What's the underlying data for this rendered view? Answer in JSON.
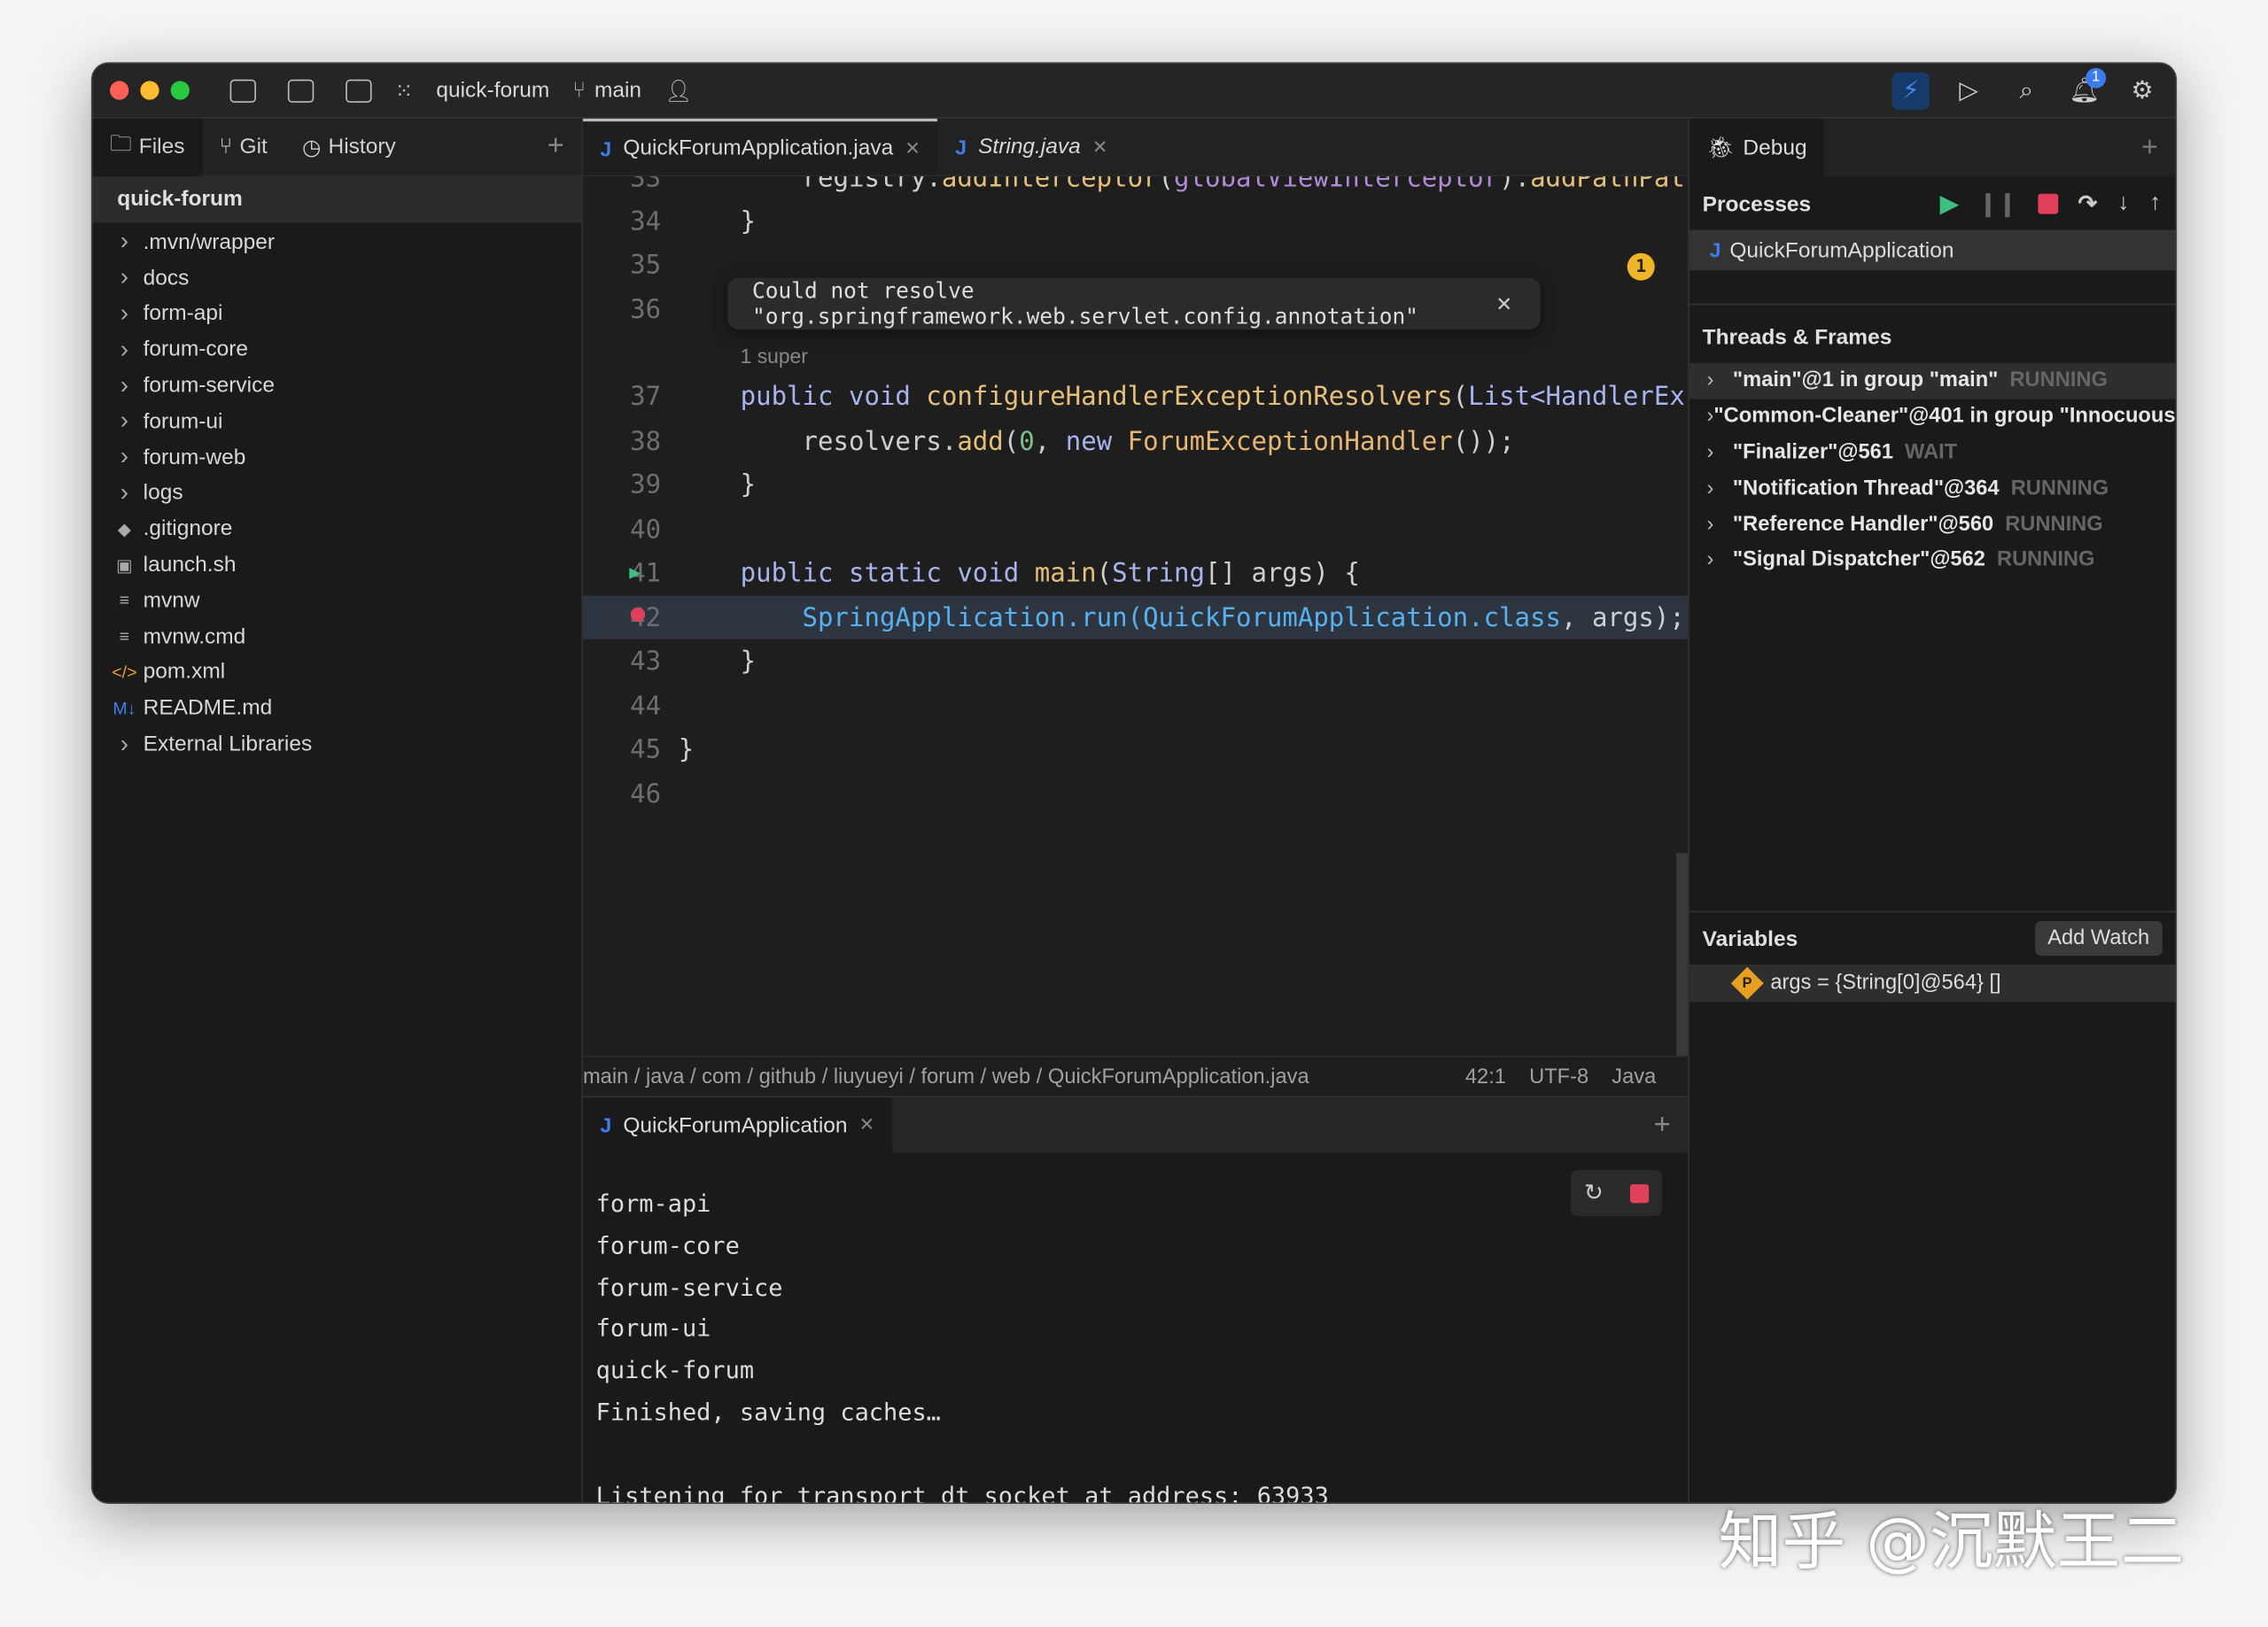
{
  "titlebar": {
    "project": "quick-forum",
    "branch": "main",
    "notifications": "1"
  },
  "left": {
    "tabs": [
      "Files",
      "Git",
      "History"
    ],
    "project": "quick-forum",
    "items": [
      {
        "label": ".mvn/wrapper",
        "icon": "chevron-right"
      },
      {
        "label": "docs",
        "icon": "chevron-right"
      },
      {
        "label": "form-api",
        "icon": "chevron-right"
      },
      {
        "label": "forum-core",
        "icon": "chevron-right"
      },
      {
        "label": "forum-service",
        "icon": "chevron-right"
      },
      {
        "label": "forum-ui",
        "icon": "chevron-right"
      },
      {
        "label": "forum-web",
        "icon": "chevron-right"
      },
      {
        "label": "logs",
        "icon": "chevron-right"
      },
      {
        "label": ".gitignore",
        "icon": "git-icon"
      },
      {
        "label": "launch.sh",
        "icon": "terminal-icon"
      },
      {
        "label": "mvnw",
        "icon": "text-file-icon"
      },
      {
        "label": "mvnw.cmd",
        "icon": "text-file-icon"
      },
      {
        "label": "pom.xml",
        "icon": "xml-icon"
      },
      {
        "label": "README.md",
        "icon": "markdown-icon"
      },
      {
        "label": "External Libraries",
        "icon": "chevron-right"
      }
    ]
  },
  "editor": {
    "tabs": [
      "QuickForumApplication.java",
      "String.java"
    ],
    "popup": "Could not resolve \"org.springframework.web.servlet.config.annotation\"",
    "warning_count": "1",
    "lines": [
      {
        "n": "33",
        "t": [
          [
            "        registry.",
            ""
          ],
          [
            "addInterceptor",
            "fn"
          ],
          [
            "(",
            ""
          ],
          [
            "globalViewInterceptor",
            "pv"
          ],
          [
            ").",
            ""
          ],
          [
            "addPathPat",
            "fn"
          ]
        ]
      },
      {
        "n": "34",
        "t": [
          [
            "    }",
            ""
          ]
        ]
      },
      {
        "n": "35",
        "t": []
      },
      {
        "n": "36",
        "t": [
          [
            "    ",
            ""
          ],
          [
            "@Override",
            "an"
          ]
        ]
      },
      {
        "n": "",
        "t": [
          [
            "    ",
            ""
          ],
          [
            "1 super",
            "hint"
          ]
        ]
      },
      {
        "n": "37",
        "t": [
          [
            "    ",
            ""
          ],
          [
            "public void ",
            "kw"
          ],
          [
            "configureHandlerExceptionResolvers",
            "fn"
          ],
          [
            "(",
            ""
          ],
          [
            "List<HandlerEx",
            "kw"
          ]
        ]
      },
      {
        "n": "38",
        "t": [
          [
            "        resolvers.",
            ""
          ],
          [
            "add",
            "fn"
          ],
          [
            "(",
            ""
          ],
          [
            "0",
            "num0"
          ],
          [
            ", ",
            ""
          ],
          [
            "new ",
            "kw"
          ],
          [
            "ForumExceptionHandler",
            "cls"
          ],
          [
            "());",
            ""
          ]
        ]
      },
      {
        "n": "39",
        "t": [
          [
            "    }",
            ""
          ]
        ]
      },
      {
        "n": "40",
        "t": []
      },
      {
        "n": "41",
        "t": [
          [
            "    ",
            ""
          ],
          [
            "public static void ",
            "kw"
          ],
          [
            "main",
            "fn"
          ],
          [
            "(",
            ""
          ],
          [
            "String",
            "kw"
          ],
          [
            "[] args) {",
            ""
          ]
        ]
      },
      {
        "n": "42",
        "t": [
          [
            "        ",
            ""
          ],
          [
            "SpringApplication.run(QuickForumApplication.class",
            "call"
          ],
          [
            ", args);",
            ""
          ]
        ]
      },
      {
        "n": "43",
        "t": [
          [
            "    }",
            ""
          ]
        ]
      },
      {
        "n": "44",
        "t": []
      },
      {
        "n": "45",
        "t": [
          [
            "}",
            ""
          ]
        ]
      },
      {
        "n": "46",
        "t": []
      }
    ]
  },
  "status": {
    "breadcrumb": "main / java / com / github / liuyueyi / forum / web / QuickForumApplication.java",
    "position": "42:1",
    "encoding": "UTF-8",
    "language": "Java"
  },
  "console": {
    "tab": "QuickForumApplication",
    "lines": [
      "form-api",
      "forum-core",
      "forum-service",
      "forum-ui",
      "quick-forum",
      "Finished, saving caches…",
      "",
      "Listening for transport dt_socket at address: 63933"
    ]
  },
  "debug": {
    "tab": "Debug",
    "processes_label": "Processes",
    "process": "QuickForumApplication",
    "threads_label": "Threads & Frames",
    "threads": [
      {
        "name": "\"main\"@1 in group \"main\"",
        "state": "RUNNING"
      },
      {
        "name": "\"Common-Cleaner\"@401 in group \"Innocuous\"",
        "state": ""
      },
      {
        "name": "\"Finalizer\"@561",
        "state": "WAIT"
      },
      {
        "name": "\"Notification Thread\"@364",
        "state": "RUNNING"
      },
      {
        "name": "\"Reference Handler\"@560",
        "state": "RUNNING"
      },
      {
        "name": "\"Signal Dispatcher\"@562",
        "state": "RUNNING"
      }
    ],
    "variables_label": "Variables",
    "add_watch": "Add Watch",
    "variable": "args = {String[0]@564} []"
  },
  "watermark": "知乎 @沉默王二"
}
